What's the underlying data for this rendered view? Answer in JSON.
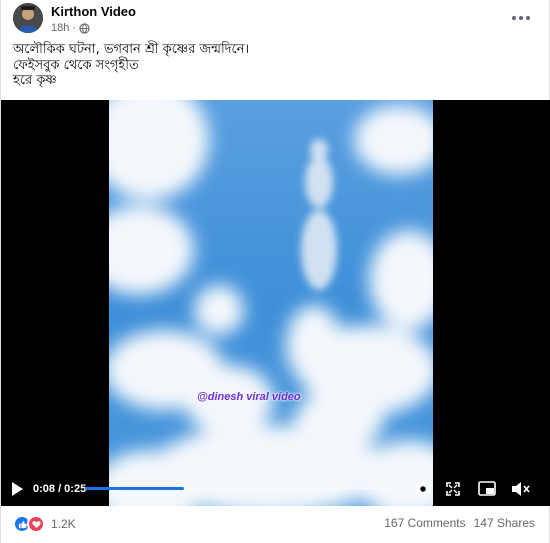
{
  "post": {
    "author": "Kirthon Video",
    "time": "18h",
    "caption_lines": [
      "অলৌকিক ঘটনা, ভগবান শ্রী কৃষ্ণের জন্মদিনে।",
      "ফেইসবুক থেকে সংগৃহীত",
      "হরে কৃষ্ণ"
    ]
  },
  "video": {
    "watermark": "@dinesh viral video",
    "current_time": "0:08",
    "duration": "0:25",
    "time_display": "0:08 / 0:25",
    "progress": 0.32
  },
  "footer": {
    "reaction_count": "1.2K",
    "comments": "167 Comments",
    "shares": "147 Shares"
  },
  "colors": {
    "accent": "#1877f2",
    "love": "#f33e58",
    "sky": "#3f8fd8"
  },
  "icons": [
    "globe-icon",
    "more-icon",
    "play-icon",
    "settings-icon",
    "fullscreen-icon",
    "picture-in-picture-icon",
    "volume-muted-icon",
    "like-icon",
    "love-icon"
  ]
}
